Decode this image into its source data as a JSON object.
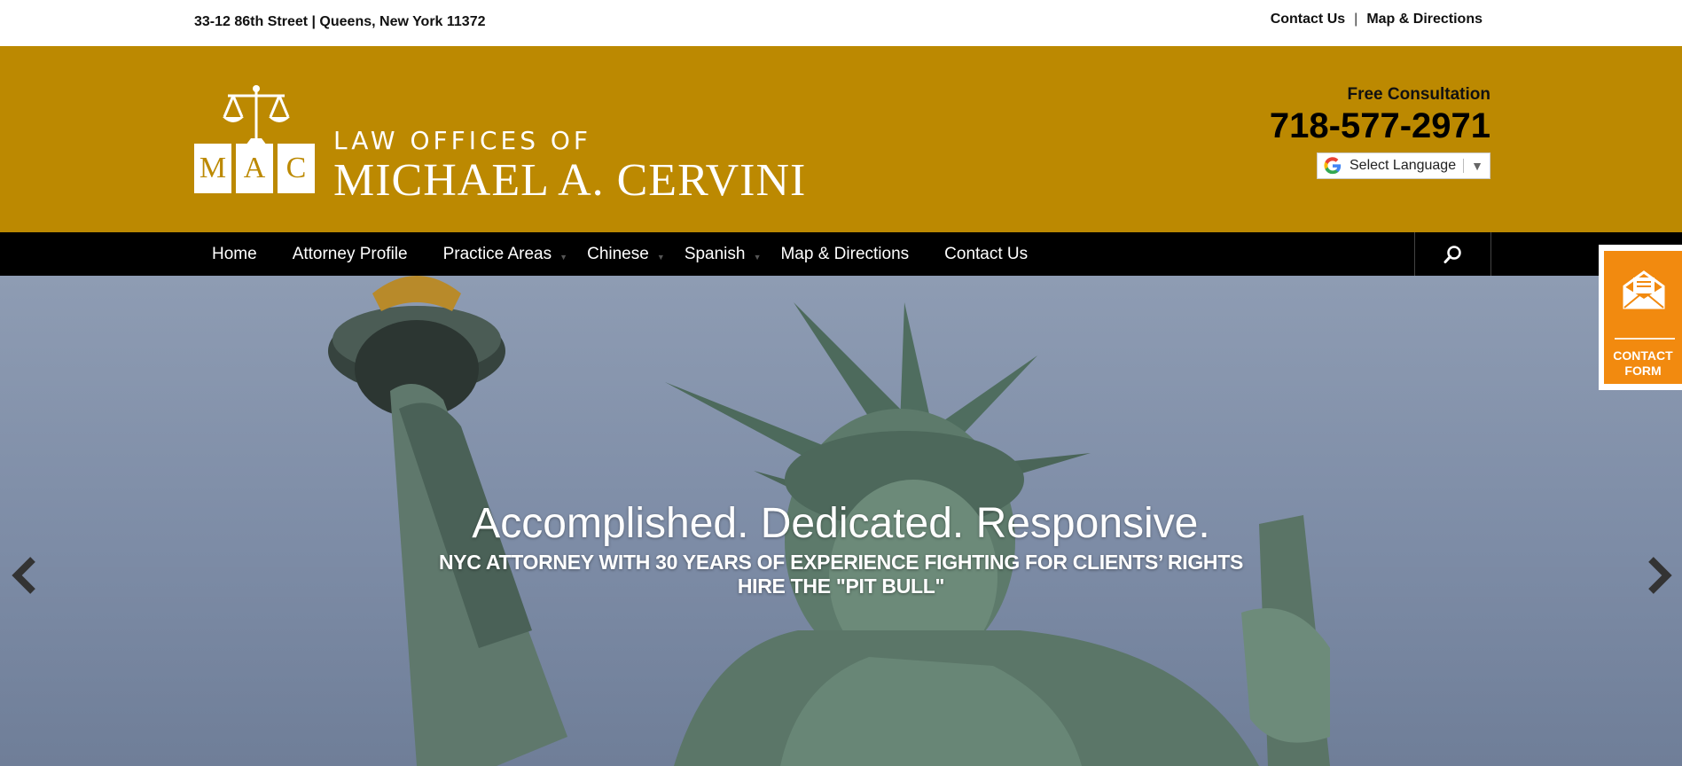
{
  "topbar": {
    "address": "33-12 86th Street | Queens, New York 11372",
    "links": [
      {
        "label": "Contact Us"
      },
      {
        "label": "Map & Directions"
      }
    ],
    "separator": "|"
  },
  "header": {
    "logo": {
      "monogram": [
        "M",
        "A",
        "C"
      ],
      "line1": "LAW OFFICES OF",
      "line2": "MICHAEL A. CERVINI"
    },
    "free_consultation": "Free Consultation",
    "phone": "718-577-2971",
    "language_select": {
      "label": "Select Language",
      "arrow": "▼"
    }
  },
  "nav": {
    "items": [
      {
        "label": "Home",
        "dropdown": false
      },
      {
        "label": "Attorney Profile",
        "dropdown": false
      },
      {
        "label": "Practice Areas",
        "dropdown": true
      },
      {
        "label": "Chinese",
        "dropdown": true
      },
      {
        "label": "Spanish",
        "dropdown": true
      },
      {
        "label": "Map & Directions",
        "dropdown": false
      },
      {
        "label": "Contact Us",
        "dropdown": false
      }
    ],
    "search_icon": "search-icon"
  },
  "hero": {
    "headline": "Accomplished. Dedicated. Responsive.",
    "subline1": "NYC ATTORNEY WITH 30 YEARS OF EXPERIENCE FIGHTING FOR CLIENTS’ RIGHTS",
    "subline2": "HIRE THE \"PIT BULL\"",
    "prev_icon": "chevron-left-icon",
    "next_icon": "chevron-right-icon"
  },
  "contact_tab": {
    "line1": "CONTACT",
    "line2": "FORM",
    "icon": "envelope-icon"
  },
  "colors": {
    "header_gold": "#bc8901",
    "nav_black": "#000000",
    "contact_orange": "#f28a0f"
  }
}
